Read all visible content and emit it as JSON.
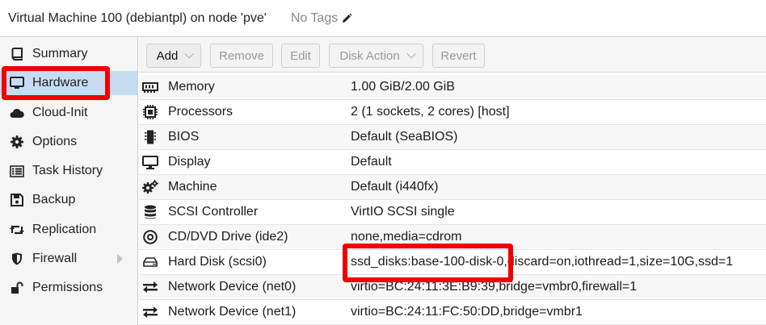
{
  "window": {
    "title": "Virtual Machine 100 (debiantpl) on node 'pve'",
    "tags": "No Tags"
  },
  "sidebar": {
    "items": [
      {
        "label": "Summary",
        "icon": "book-icon"
      },
      {
        "label": "Hardware",
        "icon": "monitor-icon",
        "selected": true
      },
      {
        "label": "Cloud-Init",
        "icon": "cloud-icon"
      },
      {
        "label": "Options",
        "icon": "gear-icon"
      },
      {
        "label": "Task History",
        "icon": "list-icon"
      },
      {
        "label": "Backup",
        "icon": "floppy-icon"
      },
      {
        "label": "Replication",
        "icon": "retweet-icon"
      },
      {
        "label": "Firewall",
        "icon": "shield-icon",
        "has_submenu": true
      },
      {
        "label": "Permissions",
        "icon": "unlock-icon"
      }
    ]
  },
  "toolbar": {
    "add_label": "Add",
    "remove_label": "Remove",
    "edit_label": "Edit",
    "disk_action_label": "Disk Action",
    "revert_label": "Revert"
  },
  "hardware": {
    "rows": [
      {
        "name": "Memory",
        "value": "1.00 GiB/2.00 GiB",
        "icon": "memory-icon"
      },
      {
        "name": "Processors",
        "value": "2 (1 sockets, 2 cores) [host]",
        "icon": "cpu-icon"
      },
      {
        "name": "BIOS",
        "value": "Default (SeaBIOS)",
        "icon": "microchip-icon"
      },
      {
        "name": "Display",
        "value": "Default",
        "icon": "desktop-icon"
      },
      {
        "name": "Machine",
        "value": "Default (i440fx)",
        "icon": "cogs-icon"
      },
      {
        "name": "SCSI Controller",
        "value": "VirtIO SCSI single",
        "icon": "database-icon"
      },
      {
        "name": "CD/DVD Drive (ide2)",
        "value": "none,media=cdrom",
        "icon": "cdrom-icon"
      },
      {
        "name": "Hard Disk (scsi0)",
        "value": "ssd_disks:base-100-disk-0,discard=on,iothread=1,size=10G,ssd=1",
        "icon": "hdd-icon"
      },
      {
        "name": "Network Device (net0)",
        "value": "virtio=BC:24:11:3E:B9:39,bridge=vmbr0,firewall=1",
        "icon": "exchange-icon"
      },
      {
        "name": "Network Device (net1)",
        "value": "virtio=BC:24:11:FC:50:DD,bridge=vmbr1",
        "icon": "exchange-icon"
      }
    ]
  },
  "colors": {
    "selected_nav": "#c6dcf2",
    "highlight": "#f00000"
  }
}
